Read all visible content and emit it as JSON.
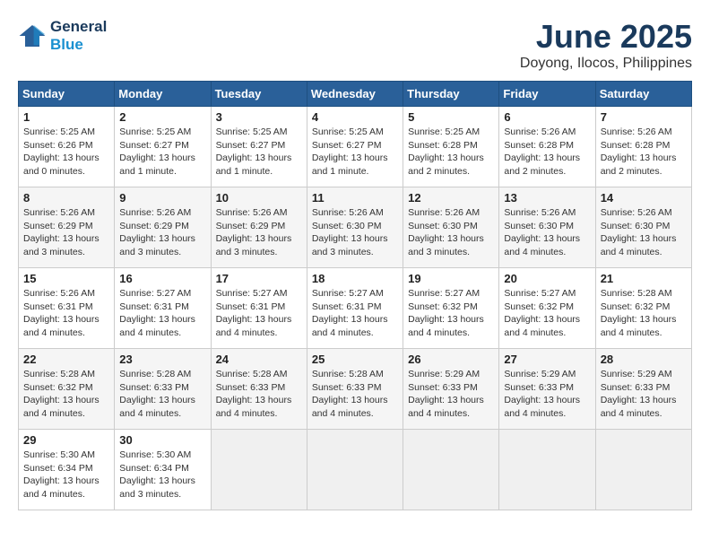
{
  "header": {
    "logo_line1": "General",
    "logo_line2": "Blue",
    "title": "June 2025",
    "subtitle": "Doyong, Ilocos, Philippines"
  },
  "columns": [
    "Sunday",
    "Monday",
    "Tuesday",
    "Wednesday",
    "Thursday",
    "Friday",
    "Saturday"
  ],
  "weeks": [
    [
      {
        "day": "1",
        "text": "Sunrise: 5:25 AM\nSunset: 6:26 PM\nDaylight: 13 hours\nand 0 minutes."
      },
      {
        "day": "2",
        "text": "Sunrise: 5:25 AM\nSunset: 6:27 PM\nDaylight: 13 hours\nand 1 minute."
      },
      {
        "day": "3",
        "text": "Sunrise: 5:25 AM\nSunset: 6:27 PM\nDaylight: 13 hours\nand 1 minute."
      },
      {
        "day": "4",
        "text": "Sunrise: 5:25 AM\nSunset: 6:27 PM\nDaylight: 13 hours\nand 1 minute."
      },
      {
        "day": "5",
        "text": "Sunrise: 5:25 AM\nSunset: 6:28 PM\nDaylight: 13 hours\nand 2 minutes."
      },
      {
        "day": "6",
        "text": "Sunrise: 5:26 AM\nSunset: 6:28 PM\nDaylight: 13 hours\nand 2 minutes."
      },
      {
        "day": "7",
        "text": "Sunrise: 5:26 AM\nSunset: 6:28 PM\nDaylight: 13 hours\nand 2 minutes."
      }
    ],
    [
      {
        "day": "8",
        "text": "Sunrise: 5:26 AM\nSunset: 6:29 PM\nDaylight: 13 hours\nand 3 minutes."
      },
      {
        "day": "9",
        "text": "Sunrise: 5:26 AM\nSunset: 6:29 PM\nDaylight: 13 hours\nand 3 minutes."
      },
      {
        "day": "10",
        "text": "Sunrise: 5:26 AM\nSunset: 6:29 PM\nDaylight: 13 hours\nand 3 minutes."
      },
      {
        "day": "11",
        "text": "Sunrise: 5:26 AM\nSunset: 6:30 PM\nDaylight: 13 hours\nand 3 minutes."
      },
      {
        "day": "12",
        "text": "Sunrise: 5:26 AM\nSunset: 6:30 PM\nDaylight: 13 hours\nand 3 minutes."
      },
      {
        "day": "13",
        "text": "Sunrise: 5:26 AM\nSunset: 6:30 PM\nDaylight: 13 hours\nand 4 minutes."
      },
      {
        "day": "14",
        "text": "Sunrise: 5:26 AM\nSunset: 6:30 PM\nDaylight: 13 hours\nand 4 minutes."
      }
    ],
    [
      {
        "day": "15",
        "text": "Sunrise: 5:26 AM\nSunset: 6:31 PM\nDaylight: 13 hours\nand 4 minutes."
      },
      {
        "day": "16",
        "text": "Sunrise: 5:27 AM\nSunset: 6:31 PM\nDaylight: 13 hours\nand 4 minutes."
      },
      {
        "day": "17",
        "text": "Sunrise: 5:27 AM\nSunset: 6:31 PM\nDaylight: 13 hours\nand 4 minutes."
      },
      {
        "day": "18",
        "text": "Sunrise: 5:27 AM\nSunset: 6:31 PM\nDaylight: 13 hours\nand 4 minutes."
      },
      {
        "day": "19",
        "text": "Sunrise: 5:27 AM\nSunset: 6:32 PM\nDaylight: 13 hours\nand 4 minutes."
      },
      {
        "day": "20",
        "text": "Sunrise: 5:27 AM\nSunset: 6:32 PM\nDaylight: 13 hours\nand 4 minutes."
      },
      {
        "day": "21",
        "text": "Sunrise: 5:28 AM\nSunset: 6:32 PM\nDaylight: 13 hours\nand 4 minutes."
      }
    ],
    [
      {
        "day": "22",
        "text": "Sunrise: 5:28 AM\nSunset: 6:32 PM\nDaylight: 13 hours\nand 4 minutes."
      },
      {
        "day": "23",
        "text": "Sunrise: 5:28 AM\nSunset: 6:33 PM\nDaylight: 13 hours\nand 4 minutes."
      },
      {
        "day": "24",
        "text": "Sunrise: 5:28 AM\nSunset: 6:33 PM\nDaylight: 13 hours\nand 4 minutes."
      },
      {
        "day": "25",
        "text": "Sunrise: 5:28 AM\nSunset: 6:33 PM\nDaylight: 13 hours\nand 4 minutes."
      },
      {
        "day": "26",
        "text": "Sunrise: 5:29 AM\nSunset: 6:33 PM\nDaylight: 13 hours\nand 4 minutes."
      },
      {
        "day": "27",
        "text": "Sunrise: 5:29 AM\nSunset: 6:33 PM\nDaylight: 13 hours\nand 4 minutes."
      },
      {
        "day": "28",
        "text": "Sunrise: 5:29 AM\nSunset: 6:33 PM\nDaylight: 13 hours\nand 4 minutes."
      }
    ],
    [
      {
        "day": "29",
        "text": "Sunrise: 5:30 AM\nSunset: 6:34 PM\nDaylight: 13 hours\nand 4 minutes."
      },
      {
        "day": "30",
        "text": "Sunrise: 5:30 AM\nSunset: 6:34 PM\nDaylight: 13 hours\nand 3 minutes."
      },
      {
        "day": "",
        "text": ""
      },
      {
        "day": "",
        "text": ""
      },
      {
        "day": "",
        "text": ""
      },
      {
        "day": "",
        "text": ""
      },
      {
        "day": "",
        "text": ""
      }
    ]
  ]
}
